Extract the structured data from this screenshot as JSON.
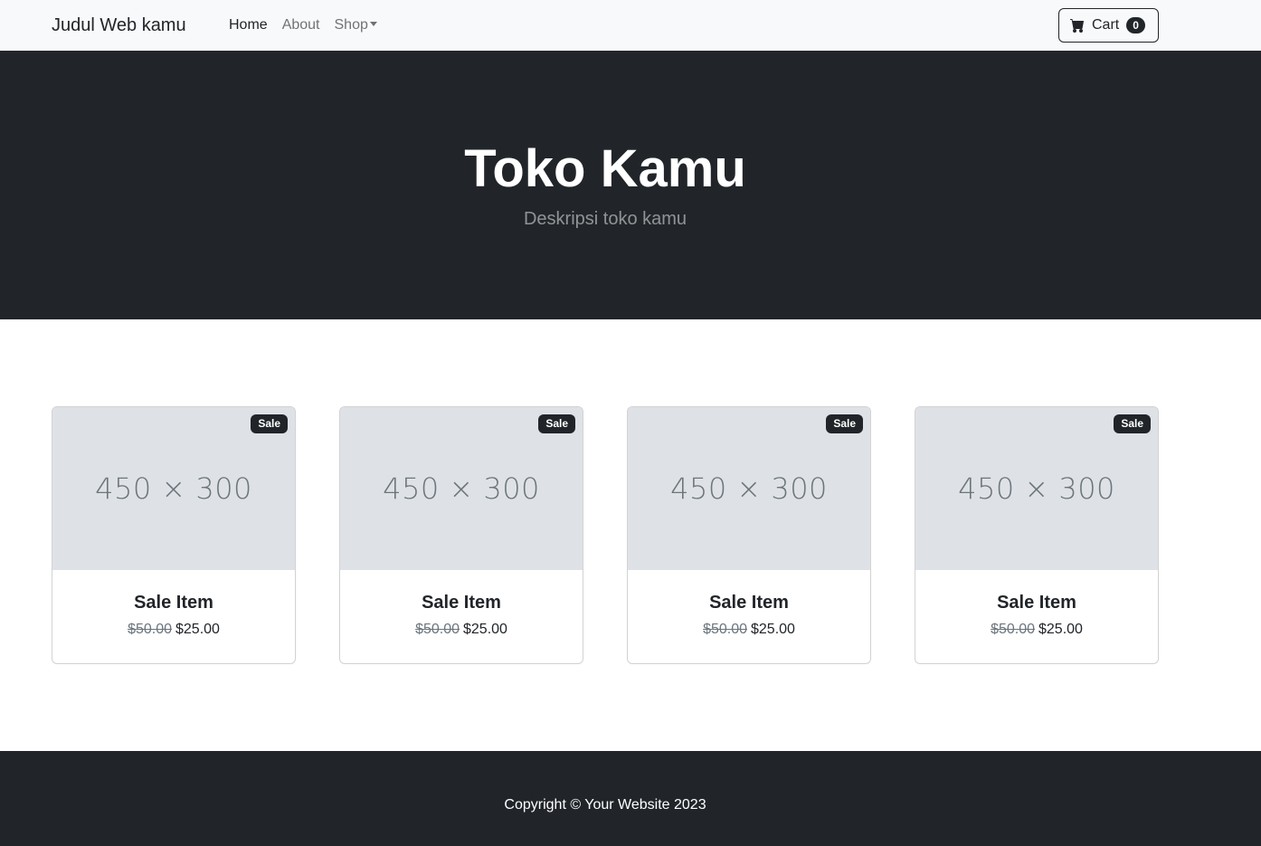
{
  "navbar": {
    "brand": "Judul Web kamu",
    "links": [
      {
        "label": "Home"
      },
      {
        "label": "About"
      },
      {
        "label": "Shop"
      }
    ],
    "cart": {
      "label": "Cart",
      "count": "0"
    }
  },
  "hero": {
    "title": "Toko Kamu",
    "subtitle": "Deskripsi toko kamu"
  },
  "products": [
    {
      "badge": "Sale",
      "image_text": "450 × 300",
      "title": "Sale Item",
      "old_price": "$50.00",
      "price": "$25.00"
    },
    {
      "badge": "Sale",
      "image_text": "450 × 300",
      "title": "Sale Item",
      "old_price": "$50.00",
      "price": "$25.00"
    },
    {
      "badge": "Sale",
      "image_text": "450 × 300",
      "title": "Sale Item",
      "old_price": "$50.00",
      "price": "$25.00"
    },
    {
      "badge": "Sale",
      "image_text": "450 × 300",
      "title": "Sale Item",
      "old_price": "$50.00",
      "price": "$25.00"
    }
  ],
  "footer": {
    "copyright": "Copyright © Your Website 2023"
  }
}
